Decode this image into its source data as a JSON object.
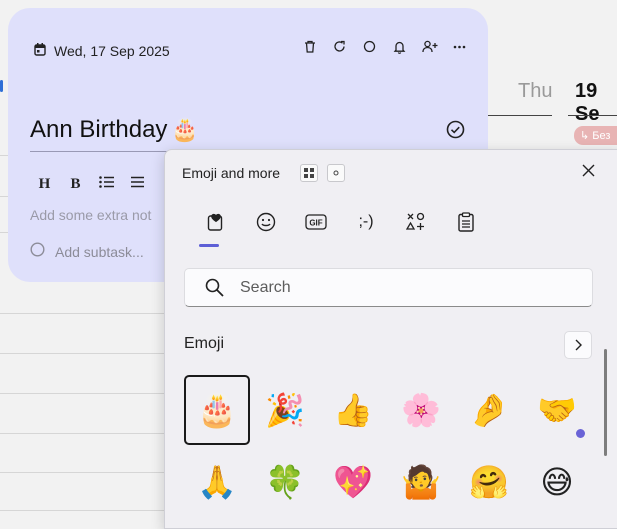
{
  "calendar": {
    "day_thu": "Thu",
    "day_19": "19 Se",
    "event_chip": "↳ Без"
  },
  "task": {
    "date": "Wed, 17 Sep 2025",
    "title": "Ann Birthday",
    "title_emoji": "🎂",
    "format_buttons": [
      "H",
      "B"
    ],
    "notes_placeholder": "Add some extra not",
    "subtask_placeholder": "Add subtask..."
  },
  "emoji_panel": {
    "title": "Emoji and more",
    "tabs": [
      "♥",
      "☺",
      "GIF",
      ";-)",
      "✳",
      "⎘"
    ],
    "search_placeholder": "Search",
    "section_title": "Emoji",
    "emojis": [
      "🎂",
      "🎉",
      "👍",
      "🌸",
      "🤌",
      "🤝",
      "🙏",
      "🍀",
      "💖",
      "🤷",
      "🤗",
      "😅"
    ],
    "selected_index": 0
  },
  "colors": {
    "card_bg": "#dfe0fb",
    "accent": "#5d5fd6"
  }
}
